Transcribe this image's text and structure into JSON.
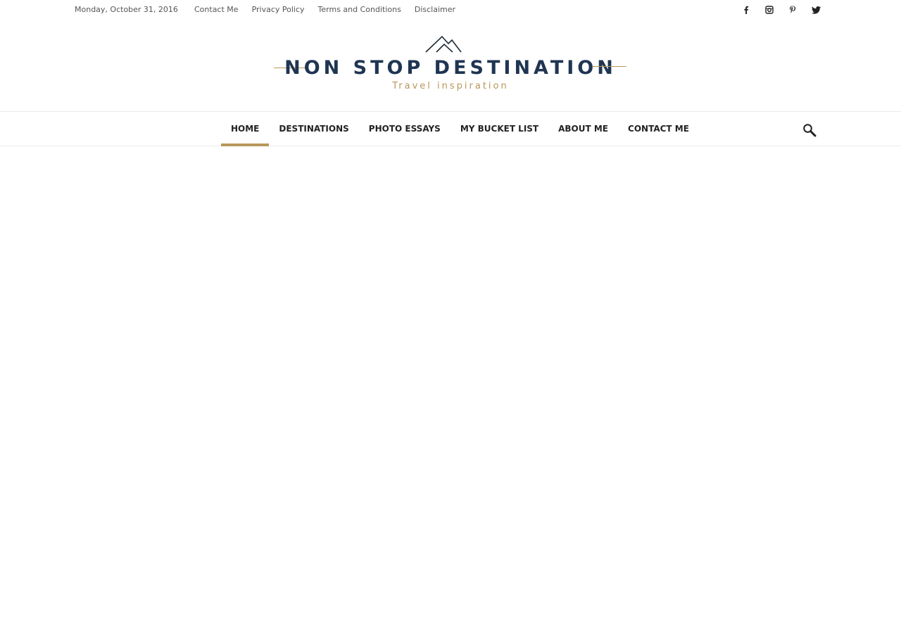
{
  "topbar": {
    "date": "Monday, October 31, 2016",
    "links": [
      "Contact Me",
      "Privacy Policy",
      "Terms and Conditions",
      "Disclaimer"
    ],
    "social_icons": [
      "facebook-icon",
      "instagram-icon",
      "pinterest-icon",
      "twitter-icon"
    ]
  },
  "logo": {
    "title": "NON STOP DESTINATION",
    "subtitle": "Travel inspiration",
    "accent_color": "#b8965a",
    "title_color": "#1f3552"
  },
  "nav": {
    "items": [
      "HOME",
      "DESTINATIONS",
      "PHOTO ESSAYS",
      "MY BUCKET LIST",
      "ABOUT ME",
      "CONTACT ME"
    ],
    "active": "HOME",
    "search_icon": "search-icon"
  }
}
